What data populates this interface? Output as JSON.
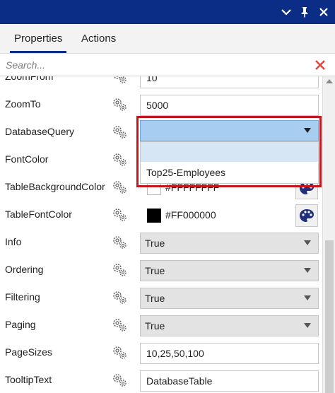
{
  "titlebar": {
    "icons": [
      "chevron-down-icon",
      "pin-icon",
      "close-icon"
    ],
    "color": "#0b2d86"
  },
  "tabs": [
    {
      "label": "Properties",
      "active": true
    },
    {
      "label": "Actions",
      "active": false
    }
  ],
  "search": {
    "placeholder": "Search...",
    "value": ""
  },
  "properties": [
    {
      "name": "ZoomFrom",
      "value": "10"
    },
    {
      "name": "ZoomTo",
      "value": "5000"
    },
    {
      "name": "DatabaseQuery",
      "value": ""
    },
    {
      "name": "FontColor",
      "value": ""
    },
    {
      "name": "TableBackgroundColor",
      "value": "#FFFFFFFF",
      "swatch": "#ffffff"
    },
    {
      "name": "TableFontColor",
      "value": "#FF000000",
      "swatch": "#000000"
    },
    {
      "name": "Info",
      "value": "True"
    },
    {
      "name": "Ordering",
      "value": "True"
    },
    {
      "name": "Filtering",
      "value": "True"
    },
    {
      "name": "Paging",
      "value": "True"
    },
    {
      "name": "PageSizes",
      "value": "10,25,50,100"
    },
    {
      "name": "TooltipText",
      "value": "DatabaseTable"
    }
  ],
  "dropdown": {
    "options": [
      "",
      "Top25-Employees"
    ],
    "highlight_color": "#c4161c"
  }
}
